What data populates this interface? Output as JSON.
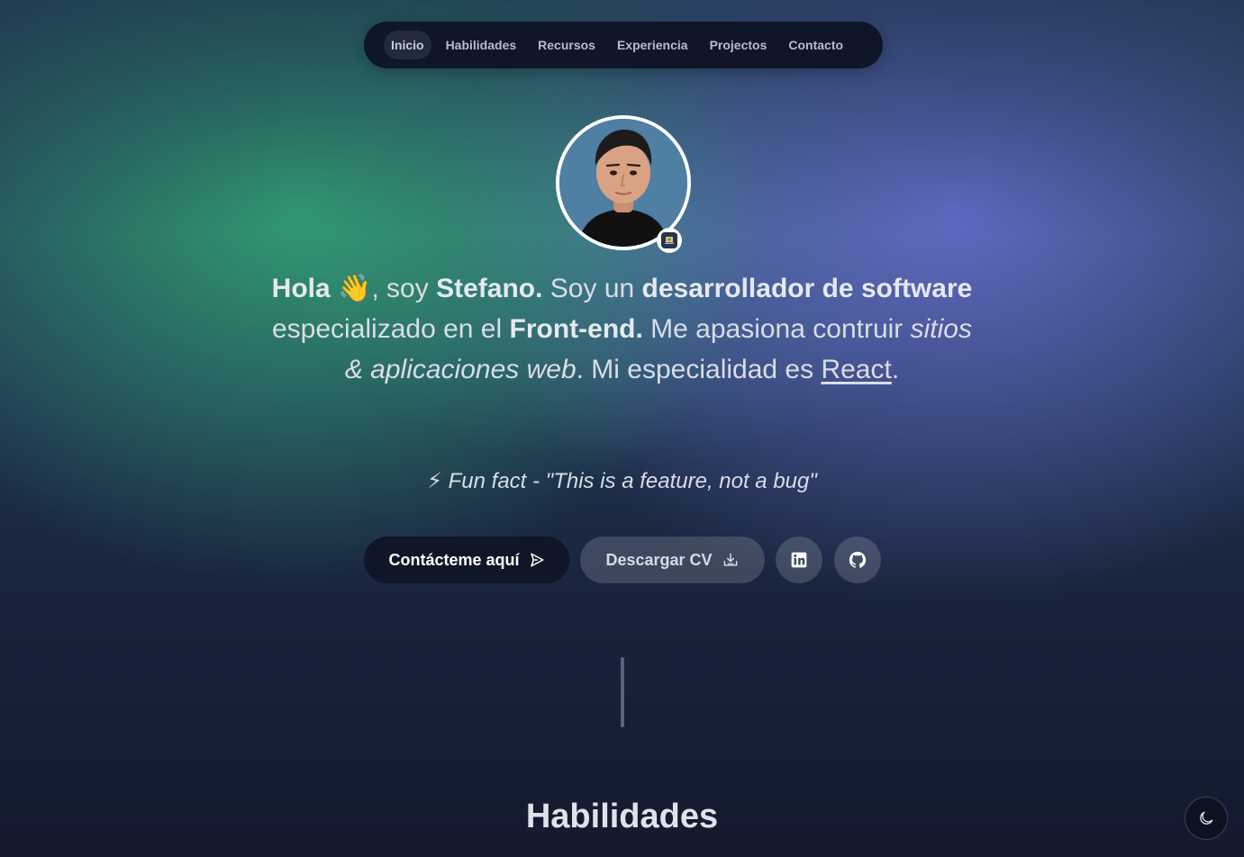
{
  "nav": {
    "items": [
      {
        "label": "Inicio",
        "active": true
      },
      {
        "label": "Habilidades"
      },
      {
        "label": "Recursos"
      },
      {
        "label": "Experiencia"
      },
      {
        "label": "Projectos"
      },
      {
        "label": "Contacto"
      }
    ]
  },
  "avatar": {
    "badge_icon": "laptop-emoji"
  },
  "hero": {
    "hola": "Hola",
    "wave": "👋",
    "soy": ", soy ",
    "name": "Stefano.",
    "soy_un": " Soy un ",
    "role": "desarrollador de software",
    "especializado": " especializado en el ",
    "frontend": "Front-end.",
    "apasiona": " Me apasiona contruir ",
    "sitios": "sitios & aplicaciones web",
    "especialidad": ". Mi especialidad es ",
    "react": "React",
    "end": "."
  },
  "funfact": {
    "icon": "⚡",
    "text": "Fun fact - \"This is a feature, not a bug\""
  },
  "buttons": {
    "contact_label": "Contácteme aquí",
    "cv_label": "Descargar CV",
    "linkedin_icon": "linkedin-icon",
    "github_icon": "github-icon"
  },
  "sections": {
    "skills_title": "Habilidades"
  },
  "theme": {
    "icon": "moon-icon"
  },
  "colors": {
    "nav_bg": "#0f1627",
    "accent_green": "#34aa78",
    "accent_purple": "#646cc8",
    "page_dark": "#131a2e"
  }
}
